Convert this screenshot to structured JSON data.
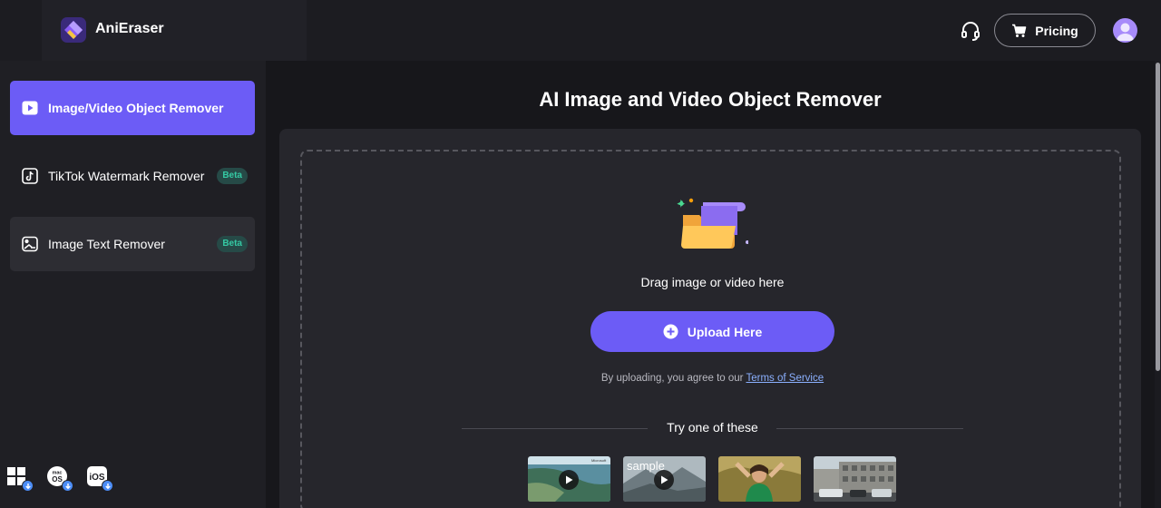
{
  "header": {
    "brand": "AniEraser",
    "support_icon": "headset-icon",
    "pricing_label": "Pricing",
    "pricing_icon": "cart-icon",
    "avatar_icon": "user-avatar-icon"
  },
  "sidebar": {
    "items": [
      {
        "label": "Image/Video Object Remover",
        "icon": "play-box-icon",
        "active": true,
        "badge": ""
      },
      {
        "label": "TikTok Watermark Remover",
        "icon": "tiktok-icon",
        "active": false,
        "badge": "Beta"
      },
      {
        "label": "Image Text Remover",
        "icon": "image-text-icon",
        "active": false,
        "badge": "Beta"
      }
    ],
    "downloads": [
      {
        "platform": "windows",
        "icon": "windows-icon"
      },
      {
        "platform": "mac",
        "label": "mac OS",
        "icon": "macos-icon"
      },
      {
        "platform": "ios",
        "label": "iOS",
        "icon": "ios-icon"
      }
    ]
  },
  "main": {
    "title": "AI Image and Video Object Remover",
    "drag_text": "Drag image or video here",
    "upload_label": "Upload Here",
    "terms_prefix": "By uploading, you agree to our ",
    "terms_link": "Terms of Service",
    "try_label": "Try one of these",
    "samples": [
      {
        "kind": "video",
        "scene": "coast",
        "watermark": "Microsoft"
      },
      {
        "kind": "video",
        "scene": "mountains",
        "alt_text": "sample"
      },
      {
        "kind": "image",
        "scene": "woman-portrait"
      },
      {
        "kind": "image",
        "scene": "city-street"
      }
    ]
  },
  "colors": {
    "accent": "#6c5cf6",
    "beta_bg": "#264a47",
    "beta_text": "#35c9a4",
    "link": "#8bb0ff",
    "panel": "#26262c"
  }
}
